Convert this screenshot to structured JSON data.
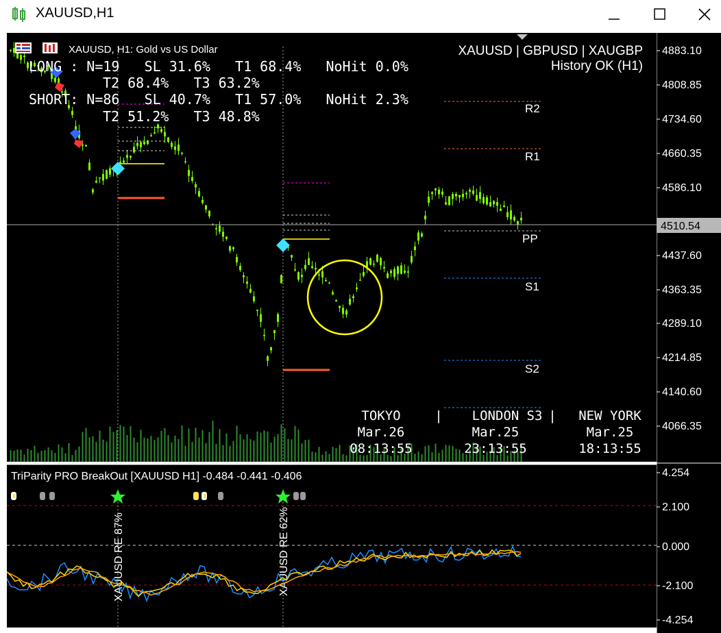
{
  "window": {
    "title": "XAUUSD,H1",
    "controls": {
      "minimize_icon": "minimize-icon",
      "maximize_icon": "maximize-icon",
      "close_icon": "close-icon"
    }
  },
  "chart": {
    "header": "XAUUSD, H1:  Gold vs US Dollar",
    "symbols": "XAUUSD | GBPUSD | XAUGBP",
    "history_status": "History OK (H1)",
    "stats": {
      "long_line1": "LONG : N=19   SL 31.6%   T1 68.4%   NoHit 0.0%",
      "long_line2": "T2 68.4%   T3 63.2%",
      "short_line1": "SHORT: N=86   SL 40.7%   T1 57.0%   NoHit 2.3%",
      "short_line2": "T2 51.2%   T3 48.8%"
    },
    "pivot_labels": {
      "r2": "R2",
      "r1": "R1",
      "pp": "PP",
      "s1": "S1",
      "s2": "S2",
      "s3": "S3"
    },
    "sessions": [
      {
        "name": "TOKYO",
        "date": "Mar.26",
        "time": "08:13:55"
      },
      {
        "name": "LONDON",
        "date": "Mar.25",
        "time": "23:13:55"
      },
      {
        "name": "NEW YORK",
        "date": "Mar.25",
        "time": "18:13:55"
      }
    ],
    "price_axis": [
      "4883.10",
      "4808.85",
      "4734.60",
      "4660.35",
      "4586.10",
      "4510.54",
      "4437.60",
      "4363.35",
      "4289.10",
      "4214.85",
      "4140.60",
      "4066.35"
    ],
    "current_price": "4510.54",
    "colors": {
      "bull": "#7fff00",
      "grid_dash": "#a0a0a0",
      "pivot_r": "#ff6347",
      "pivot_s": "#1e90ff",
      "pp": "#c0c0c0",
      "highlight_circle": "#ffff00"
    }
  },
  "indicator": {
    "header": "TriParity PRO BreakOut [XAUUSD H1] -0.484 -0.441 -0.406",
    "axis": [
      "4.254",
      "2.100",
      "0.000",
      "-2.100",
      "-4.254"
    ],
    "labels": [
      "XAUUSD RE 87%",
      "XAUUSD RE 62%"
    ],
    "colors": {
      "line1": "#1e90ff",
      "line2": "#ffd700",
      "line3": "#ffa500",
      "band": "#cc0000"
    }
  }
}
